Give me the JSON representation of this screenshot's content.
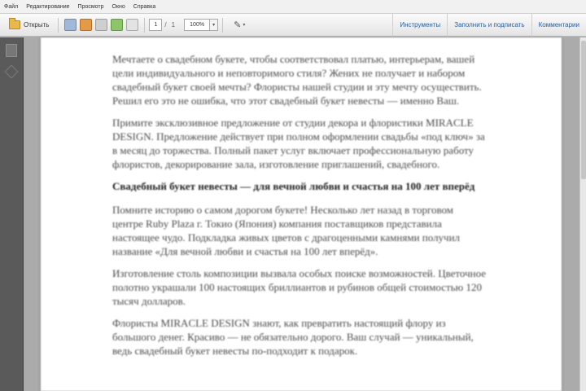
{
  "menu": [
    "Файл",
    "Редактирование",
    "Просмотр",
    "Окно",
    "Справка"
  ],
  "toolbar": {
    "open_label": "Открыть",
    "page_current": "1",
    "page_total": "1",
    "zoom": "100%",
    "links": [
      "Инструменты",
      "Заполнить и подписать",
      "Комментарии"
    ]
  },
  "document": {
    "paragraphs": [
      "Мечтаете о свадебном букете, чтобы соответствовал платью, интерьерам, вашей цели индивидуального и неповторимого стиля? Жених не получает и набором свадебный букет своей мечты? Флористы нашей студии и эту мечту осуществить. Решил его это не ошибка, что этот свадебный букет невесты — именно Ваш.",
      "Примите эксклюзивное предложение от студии декора и флористики MIRACLE DESIGN. Предложение действует при полном оформлении свадьбы «под ключ» за в месяц до торжества. Полный пакет услуг включает профессиональную работу флористов, декорирование зала, изготовление приглашений, свадебного."
    ],
    "heading": "Свадебный букет невесты — для вечной любви и счастья на 100 лет вперёд",
    "paragraphs2": [
      "Помните историю о самом дорогом букете! Несколько лет назад в торговом центре Ruby Plaza г. Токио (Япония) компания поставщиков представила настоящее чудо. Подкладка живых цветов с драгоценными камнями получил название «Для вечной любви и счастья на 100 лет вперёд».",
      "Изготовление столь композиции вызвала особых поиске возможностей. Цветочное полотно украшали 100 настоящих бриллиантов и рубинов общей стоимостью 120 тысяч долларов.",
      "Флористы MIRACLE DESIGN знают, как превратить настоящий флору из большого денег. Красиво — не обязательно дорого. Ваш случай — уникальный, ведь свадебный букет невесты по-подходит к подарок."
    ]
  }
}
